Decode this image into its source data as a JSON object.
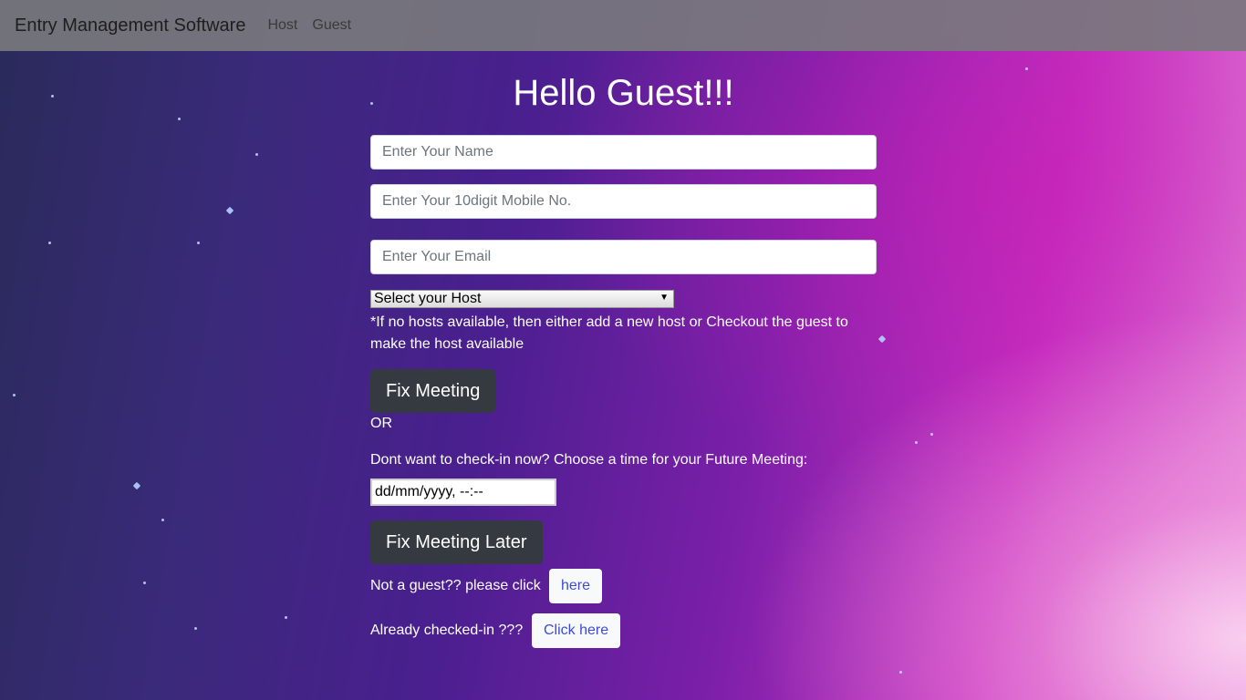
{
  "navbar": {
    "brand": "Entry Management Software",
    "links": [
      "Host",
      "Guest"
    ]
  },
  "main": {
    "title": "Hello Guest!!!",
    "name_placeholder": "Enter Your Name",
    "mobile_placeholder": "Enter Your 10digit Mobile No.",
    "email_placeholder": "Enter Your Email",
    "host_select": "Select your Host",
    "host_note": "*If no hosts available, then either add a new host or Checkout the guest to make the host available",
    "fix_meeting": "Fix Meeting",
    "or_text": "OR",
    "future_text": "Dont want to check-in now? Choose a time for your Future Meeting:",
    "datetime_value": "dd/mm/yyyy, --:--",
    "fix_meeting_later": "Fix Meeting Later",
    "not_guest_text": "Not a guest?? please click",
    "not_guest_button": "here",
    "checked_in_text": "Already checked-in ???",
    "checked_in_button": "Click here"
  }
}
